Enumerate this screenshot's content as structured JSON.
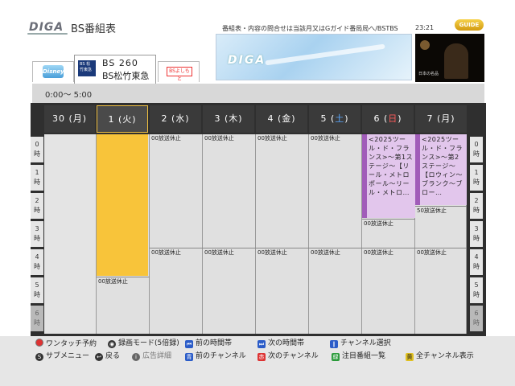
{
  "header": {
    "logo": "DIGA",
    "title": "BS番組表",
    "notice": "番組表・内容の問合せは当該月又はGガイド番局局へ/BSTBS",
    "clock": "23:21",
    "guide_logo": "GUIDE"
  },
  "ad": {
    "brand": "DIGA"
  },
  "preview": {
    "subtitle": "日本の名品"
  },
  "channels": {
    "disney": {
      "mark": "Disney"
    },
    "active": {
      "mark": "BS 松竹東急",
      "number": "BS 260",
      "name": "BS松竹東急"
    },
    "yoshimoto": {
      "mark": "BSよしもと"
    }
  },
  "time_range": "0:00～ 5:00",
  "days": [
    {
      "date": "30",
      "dow": "月",
      "type": "weekday"
    },
    {
      "date": "1",
      "dow": "火",
      "type": "weekday"
    },
    {
      "date": "2",
      "dow": "水",
      "type": "weekday"
    },
    {
      "date": "3",
      "dow": "木",
      "type": "weekday"
    },
    {
      "date": "4",
      "dow": "金",
      "type": "weekday"
    },
    {
      "date": "5",
      "dow": "土",
      "type": "saturday"
    },
    {
      "date": "6",
      "dow": "日",
      "type": "sunday"
    },
    {
      "date": "7",
      "dow": "月",
      "type": "weekday"
    }
  ],
  "hours": [
    {
      "h": "0",
      "unit": "時"
    },
    {
      "h": "1",
      "unit": "時"
    },
    {
      "h": "2",
      "unit": "時"
    },
    {
      "h": "3",
      "unit": "時"
    },
    {
      "h": "4",
      "unit": "時"
    },
    {
      "h": "5",
      "unit": "時"
    },
    {
      "h": "6",
      "unit": "時"
    }
  ],
  "programs": {
    "off_air": "00放送休止",
    "special_6": "<2025ツール・ド・フランス>～第1ステージ～【リール・メトロポール～リール・メトロ…",
    "special_7": "<2025ツール・ド・フランス>～第2ステージ～【ロウィン～ブランク～ブロー…",
    "off_air_7": "50放送休止"
  },
  "footer": {
    "row1": [
      {
        "icon": "red-circle-icon",
        "label": "ワンタッチ予約"
      },
      {
        "icon": "record-mode-icon",
        "label": "録画モード(5倍録)"
      },
      {
        "icon": "rewind-icon",
        "label": "前の時間帯"
      },
      {
        "icon": "fast-forward-icon",
        "label": "次の時間帯"
      },
      {
        "icon": "pause-icon",
        "label": "チャンネル選択"
      }
    ],
    "row2": [
      {
        "icon": "submenu-icon",
        "label": "サブメニュー"
      },
      {
        "icon": "back-icon",
        "label": "戻る"
      },
      {
        "icon": "info-icon",
        "label": "広告詳細"
      },
      {
        "icon": "blue-button-icon",
        "label": "前のチャンネル"
      },
      {
        "icon": "red-button-icon",
        "label": "次のチャンネル"
      },
      {
        "icon": "green-button-icon",
        "label": "注目番組一覧"
      },
      {
        "icon": "yellow-button-icon",
        "label": "全チャンネル表示"
      }
    ]
  }
}
